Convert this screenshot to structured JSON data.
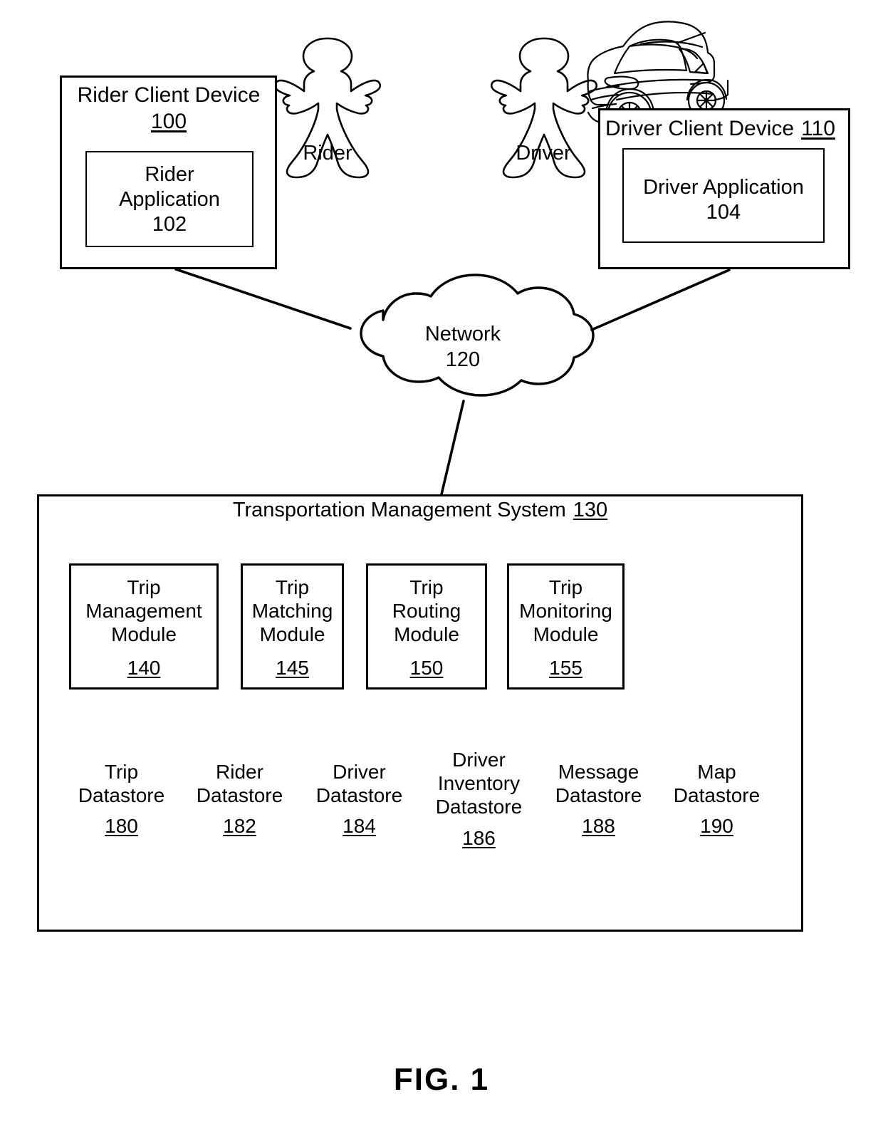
{
  "figure": {
    "caption": "FIG. 1",
    "stroke_color": "#000000",
    "background_color": "#ffffff"
  },
  "actors": [
    {
      "id": "rider",
      "label": "Rider",
      "icon": "person-icon"
    },
    {
      "id": "driver",
      "label": "Driver",
      "icon": "person-icon"
    }
  ],
  "vehicle": {
    "icon": "car-icon",
    "label": ""
  },
  "rider_client_device": {
    "title": "Rider Client Device",
    "ref": "100",
    "inner": {
      "title_line1": "Rider",
      "title_line2": "Application",
      "ref": "102"
    }
  },
  "driver_client_device": {
    "title": "Driver Client Device",
    "ref": "110",
    "inner": {
      "title": "Driver Application",
      "ref": "104"
    }
  },
  "network": {
    "label": "Network",
    "ref": "120",
    "shape": "cloud-icon"
  },
  "transportation_management_system": {
    "title": "Transportation Management System",
    "ref": "130",
    "modules": [
      {
        "name": "Trip\nManagement\nModule",
        "ref": "140"
      },
      {
        "name": "Trip\nMatching\nModule",
        "ref": "145"
      },
      {
        "name": "Trip\nRouting\nModule",
        "ref": "150"
      },
      {
        "name": "Trip\nMonitoring\nModule",
        "ref": "155"
      }
    ],
    "datastores": [
      {
        "name": "Trip\nDatastore",
        "ref": "180"
      },
      {
        "name": "Rider\nDatastore",
        "ref": "182"
      },
      {
        "name": "Driver\nDatastore",
        "ref": "184"
      },
      {
        "name": "Driver\nInventory\nDatastore",
        "ref": "186"
      },
      {
        "name": "Message\nDatastore",
        "ref": "188"
      },
      {
        "name": "Map\nDatastore",
        "ref": "190"
      }
    ]
  },
  "connections": [
    {
      "from": "rider_client_device",
      "to": "network"
    },
    {
      "from": "driver_client_device",
      "to": "network"
    },
    {
      "from": "network",
      "to": "transportation_management_system"
    }
  ]
}
